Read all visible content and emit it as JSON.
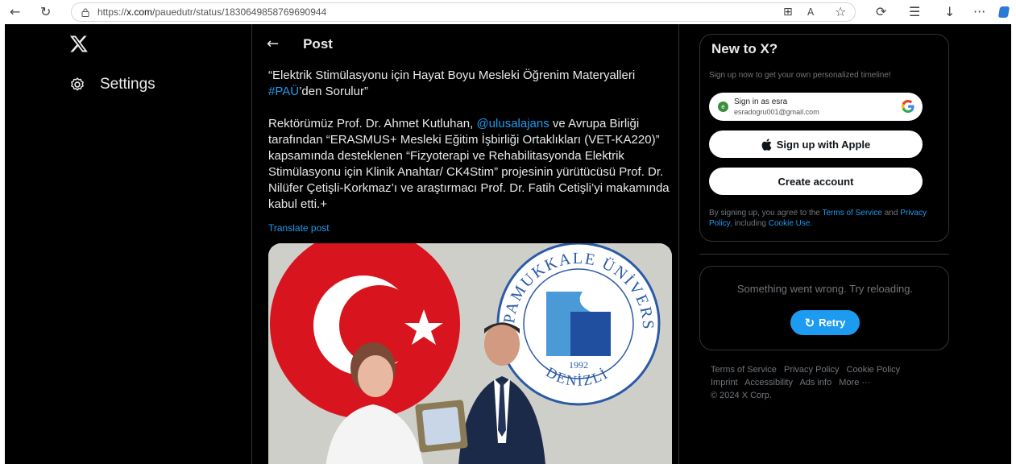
{
  "browser": {
    "url_prefix": "https://",
    "url_domain": "x.com",
    "url_path": "/pauedutr/status/1830649858769690944",
    "icons": [
      "back-arrow-icon",
      "refresh-icon",
      "lock-icon",
      "reader-icon",
      "read-aloud-icon",
      "favorite-star-icon",
      "extensions-icon",
      "favorites-icon",
      "downloads-icon",
      "more-icon",
      "copilot-icon"
    ]
  },
  "sidebar": {
    "settings_label": "Settings"
  },
  "post": {
    "header_title": "Post",
    "quote_line1": "“Elektrik Stimülasyonu için Hayat Boyu Mesleki Öğrenim Materyalleri",
    "hashtag": "#PAÜ",
    "quote_line2_rest": "’den Sorulur”",
    "body_start": "Rektörümüz Prof. Dr. Ahmet Kutluhan, ",
    "mention": "@ulusalajans",
    "body_rest": " ve Avrupa Birliği tarafından “ERASMUS+ Mesleki Eğitim İşbirliği Ortaklıkları (VET-KA220)” kapsamında desteklenen “Fizyoterapi ve Rehabilitasyonda Elektrik Stimülasyonu için Klinik Anahtar/ CK4Stim” projesinin yürütücüsü Prof. Dr. Nilüfer Çetişli-Korkmaz’ı ve araştırmacı Prof. Dr. Fatih Cetişli’yi makamında kabul etti.+",
    "translate_label": "Translate post",
    "seal_top": "PAMUKKALE ÜNİVERSİTESİ",
    "seal_year": "1992",
    "seal_bottom": "DENİZLİ"
  },
  "signup": {
    "title": "New to X?",
    "subtitle": "Sign up now to get your own personalized timeline!",
    "google_line1": "Sign in as esra",
    "google_line2": "esradogru001@gmail.com",
    "avatar_letter": "e",
    "apple_label": "Sign up with Apple",
    "create_label": "Create account",
    "legal_prefix": "By signing up, you agree to the ",
    "terms_link": "Terms of Service",
    "legal_and": " and ",
    "privacy_link": "Privacy Policy",
    "legal_including": ", including ",
    "cookie_link": "Cookie Use",
    "legal_end": "."
  },
  "error_panel": {
    "message": "Something went wrong. Try reloading.",
    "retry_label": "Retry"
  },
  "footer": {
    "links": [
      "Terms of Service",
      "Privacy Policy",
      "Cookie Policy",
      "Imprint",
      "Accessibility",
      "Ads info",
      "More ···"
    ],
    "copyright": "© 2024 X Corp."
  },
  "colors": {
    "background": "#000000",
    "accent": "#1d9bf0",
    "muted_text": "#71767b",
    "primary_text": "#e7e9ea"
  }
}
